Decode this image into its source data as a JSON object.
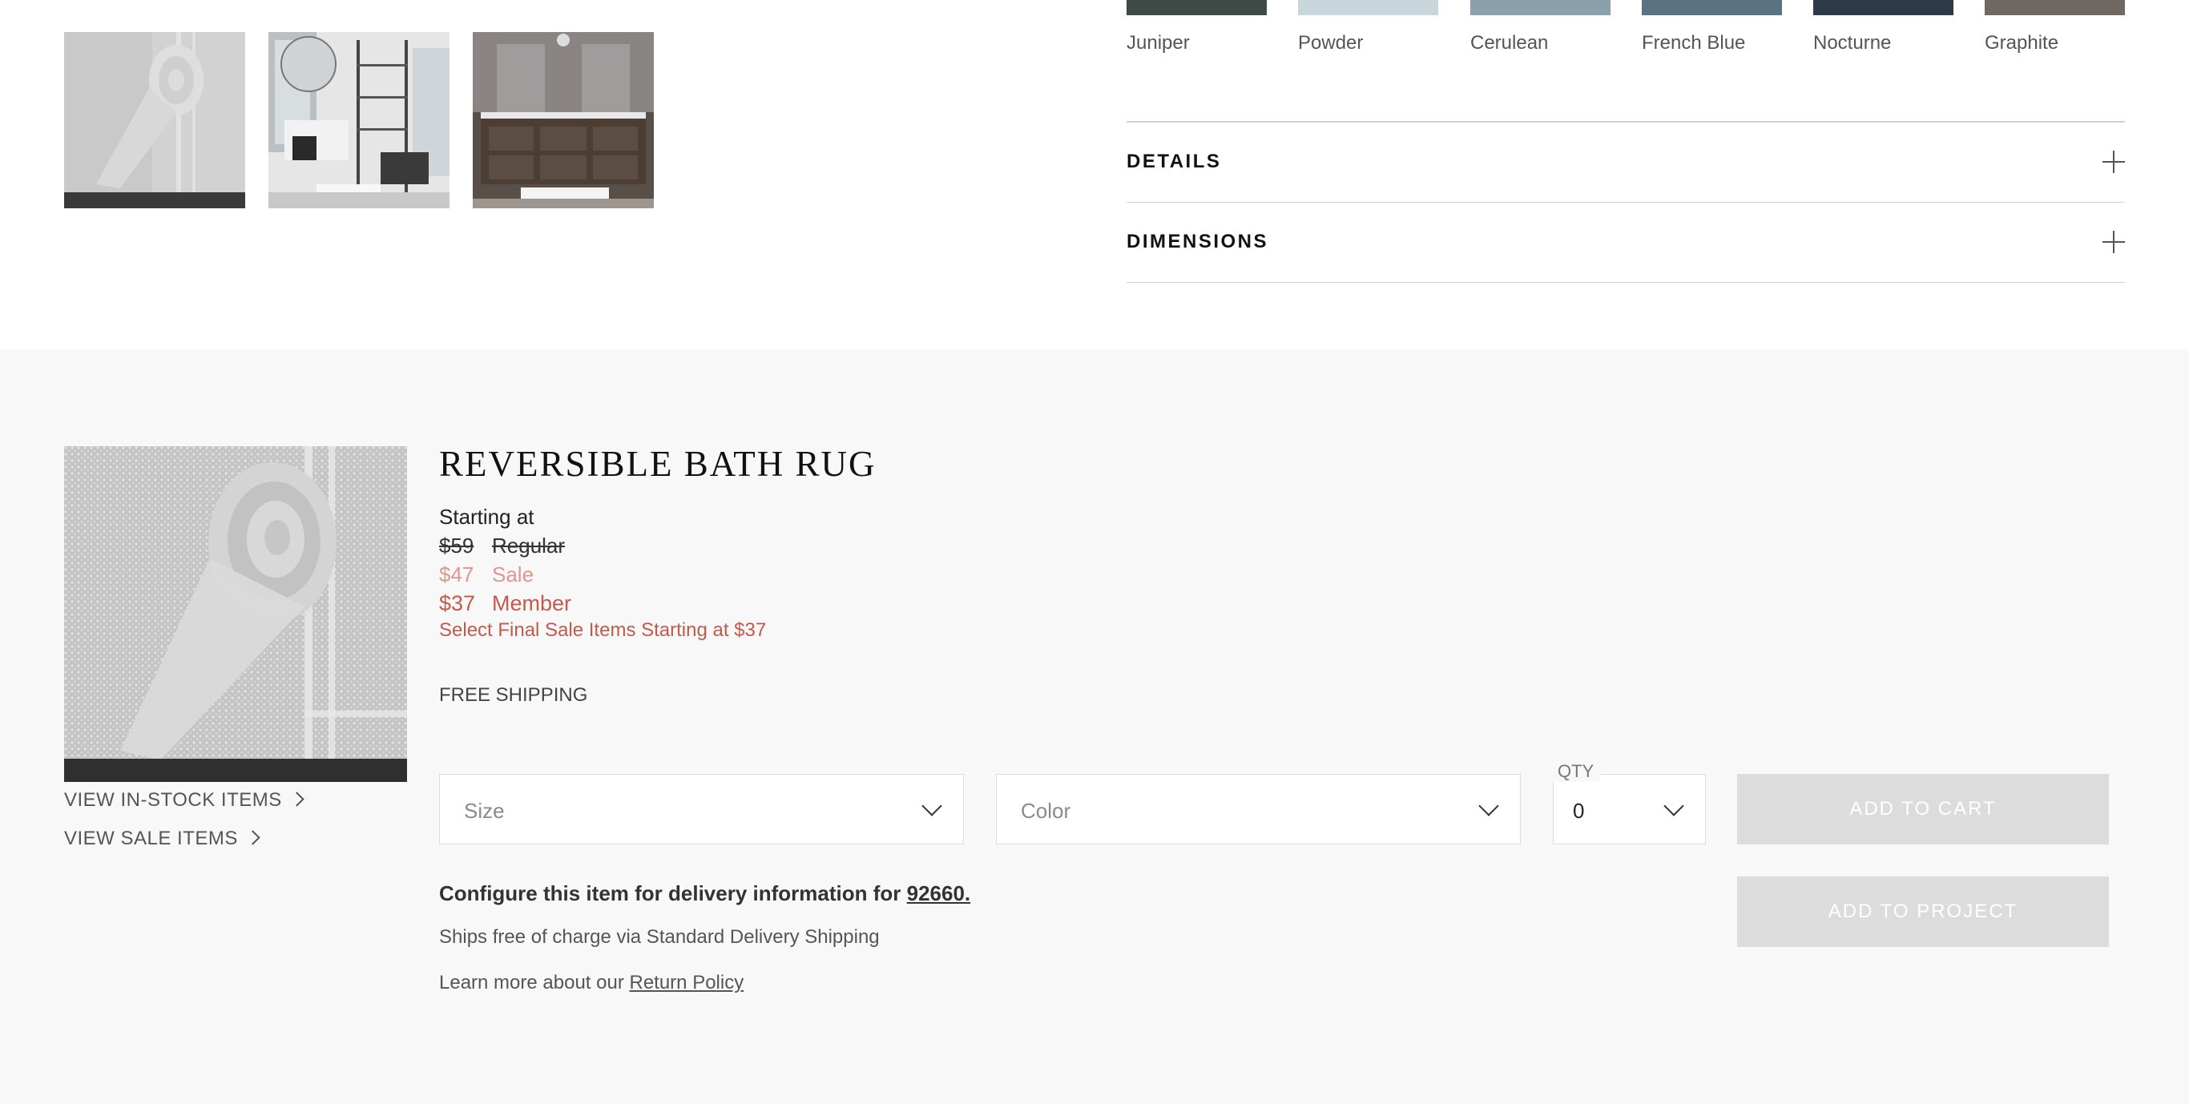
{
  "gallery": {
    "thumbnails": [
      "rolled bath rug",
      "bathroom with shelving",
      "bathroom vanity"
    ]
  },
  "swatches": [
    {
      "name": "Juniper",
      "color": "#3e4a44"
    },
    {
      "name": "Powder",
      "color": "#c9d6dc"
    },
    {
      "name": "Cerulean",
      "color": "#8aa0aa"
    },
    {
      "name": "French Blue",
      "color": "#5b7283"
    },
    {
      "name": "Nocturne",
      "color": "#2d3a4a"
    },
    {
      "name": "Graphite",
      "color": "#6f6863"
    }
  ],
  "accordions": {
    "details": "DETAILS",
    "dimensions": "DIMENSIONS"
  },
  "product": {
    "title": "REVERSIBLE BATH RUG",
    "starting_at": "Starting at",
    "regular_price": "$59",
    "regular_label": "Regular",
    "sale_price": "$47",
    "sale_label": "Sale",
    "member_price": "$37",
    "member_label": "Member",
    "final_sale": "Select Final Sale Items Starting at $37",
    "shipping": "FREE SHIPPING"
  },
  "links": {
    "in_stock": "VIEW IN-STOCK ITEMS",
    "sale_items": "VIEW SALE ITEMS"
  },
  "selectors": {
    "size_placeholder": "Size",
    "color_placeholder": "Color",
    "qty_label": "QTY",
    "qty_value": "0"
  },
  "buttons": {
    "add_to_cart": "ADD TO CART",
    "add_to_project": "ADD TO PROJECT"
  },
  "delivery": {
    "configure_text": "Configure this item for delivery information for",
    "zip": "92660.",
    "ships_text": "Ships free of charge via Standard Delivery Shipping",
    "learn_more": "Learn more about our",
    "return_policy": "Return Policy"
  },
  "colors": {
    "panel_bg": "#f8f8f8",
    "sale": "#e0968a",
    "member": "#c35a4e",
    "button_disabled": "#dcdcdc"
  }
}
